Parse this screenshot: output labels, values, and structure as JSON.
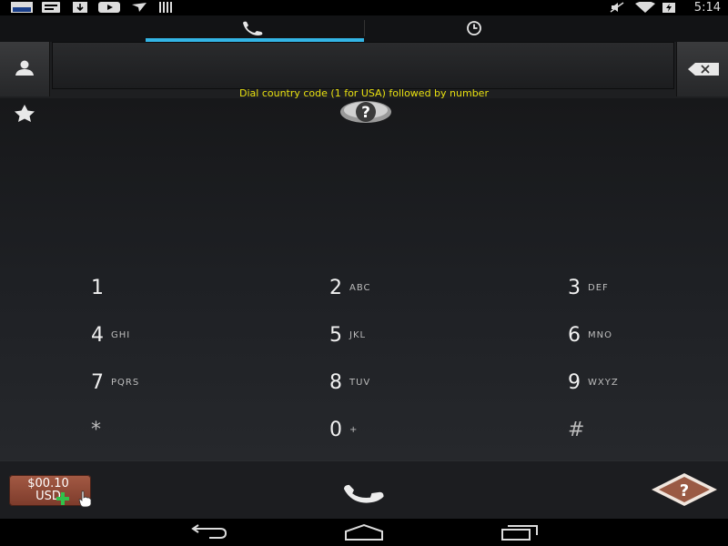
{
  "status_bar": {
    "time": "5:14",
    "icons_left": [
      "news-app-icon",
      "message-icon",
      "download-icon",
      "youtube-icon",
      "flight-icon",
      "barcode-icon"
    ],
    "icons_right": [
      "mute-icon",
      "wifi-icon",
      "battery-icon"
    ]
  },
  "tabs": [
    {
      "name": "dialer",
      "icon": "phone-icon",
      "selected": true
    },
    {
      "name": "history",
      "icon": "clock-icon",
      "selected": false
    }
  ],
  "dialer": {
    "number_value": "",
    "hint": "Dial country code (1 for USA) followed by number",
    "keys": [
      {
        "digit": "1",
        "letters": ""
      },
      {
        "digit": "2",
        "letters": "ABC"
      },
      {
        "digit": "3",
        "letters": "DEF"
      },
      {
        "digit": "4",
        "letters": "GHI"
      },
      {
        "digit": "5",
        "letters": "JKL"
      },
      {
        "digit": "6",
        "letters": "MNO"
      },
      {
        "digit": "7",
        "letters": "PQRS"
      },
      {
        "digit": "8",
        "letters": "TUV"
      },
      {
        "digit": "9",
        "letters": "WXYZ"
      },
      {
        "digit": "*",
        "letters": ""
      },
      {
        "digit": "0",
        "letters": "+"
      },
      {
        "digit": "#",
        "letters": ""
      }
    ]
  },
  "bottom": {
    "credit_amount": "$00.10",
    "credit_currency": "USD",
    "help_symbol": "?",
    "badge_symbol": "?"
  },
  "colors": {
    "accent": "#33b5e5",
    "hint": "#e8e010",
    "credit": "#8f4a36"
  }
}
